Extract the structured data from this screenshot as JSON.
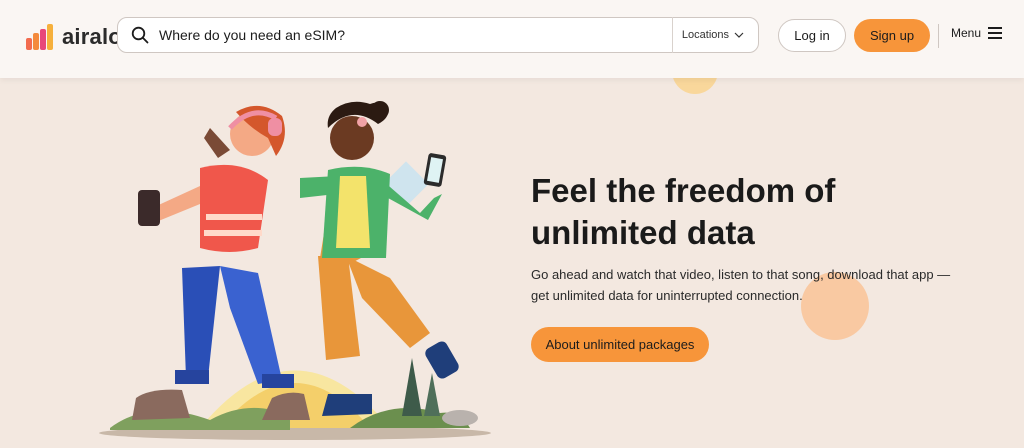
{
  "header": {
    "logo_text": "airalo",
    "search": {
      "placeholder": "Where do you need an eSIM?",
      "locations_label": "Locations"
    },
    "login_label": "Log in",
    "signup_label": "Sign up",
    "menu_label": "Menu"
  },
  "hero": {
    "title": "Feel the freedom of unlimited data",
    "description": "Go ahead and watch that video, listen to that song, download that app — get unlimited data for uninterrupted connection.",
    "cta_label": "About unlimited packages"
  },
  "colors": {
    "accent": "#f7953a",
    "background": "#f3e8e0",
    "header_background": "#faf6f3"
  },
  "icons": [
    "search-icon",
    "chevron-down-icon",
    "hamburger-menu-icon"
  ]
}
